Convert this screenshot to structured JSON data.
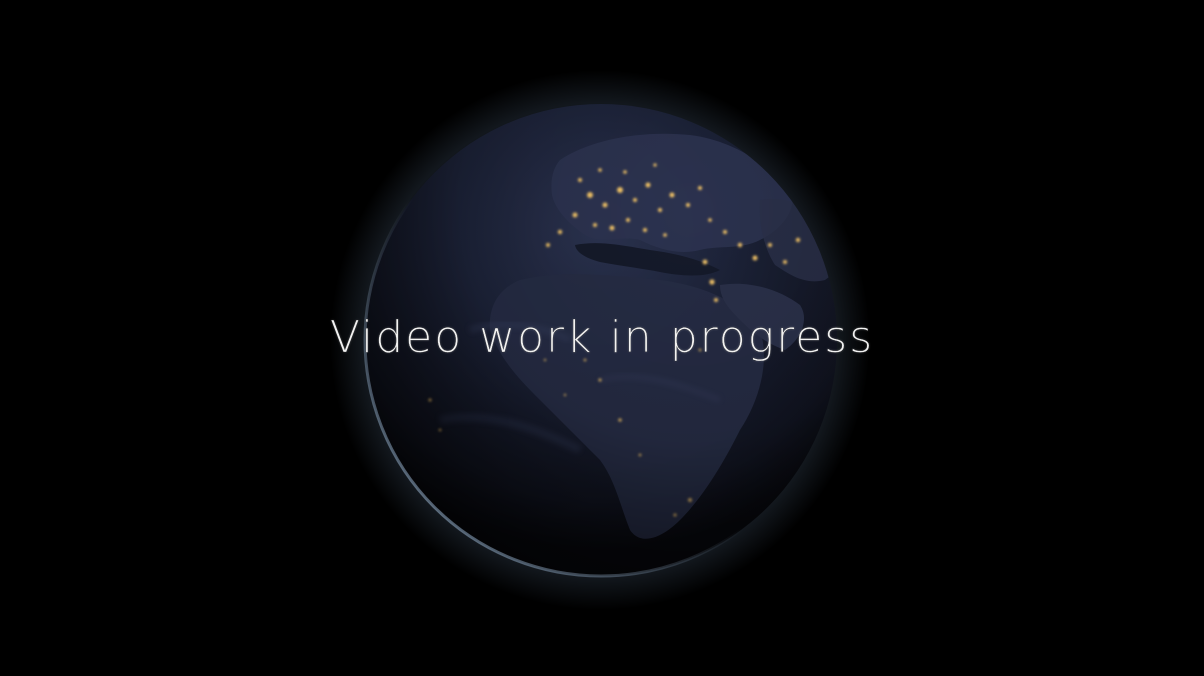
{
  "screen": {
    "message": "Video work in progress",
    "background_color": "#000000",
    "text_color": "#f2f2f2"
  },
  "image": {
    "subject": "earth-at-night-globe",
    "colors": {
      "ocean": "#1d2336",
      "land": "#2a3047",
      "city_lights": "#f3c467",
      "rim_light": "#a9c7e6"
    }
  }
}
